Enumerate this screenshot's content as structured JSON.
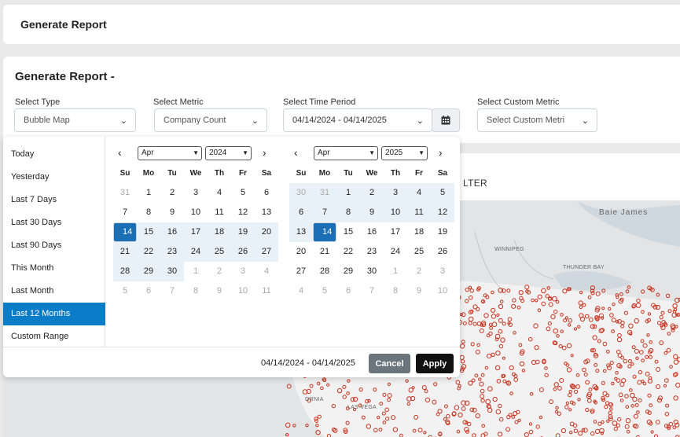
{
  "top": {
    "title": "Generate Report"
  },
  "main": {
    "heading": "Generate Report -",
    "type": {
      "label": "Select Type",
      "value": "Bubble Map"
    },
    "metric": {
      "label": "Select Metric",
      "value": "Company Count"
    },
    "period": {
      "label": "Select Time Period",
      "value": "04/14/2024 - 04/14/2025"
    },
    "custom": {
      "label": "Select Custom Metric",
      "value": "Select Custom Metri"
    }
  },
  "map": {
    "filter_label": "LTER",
    "labels": {
      "winnipeg": "WINNIPEG",
      "thunder_bay": "THUNDER BAY",
      "baie_james": "Baie James",
      "california": "ORNIA",
      "las_vegas": "LAS VEGA"
    },
    "dot_color": "#c8321e"
  },
  "picker": {
    "ranges": [
      "Today",
      "Yesterday",
      "Last 7 Days",
      "Last 30 Days",
      "Last 90 Days",
      "This Month",
      "Last Month",
      "Last 12 Months",
      "Custom Range"
    ],
    "active_range": "Last 12 Months",
    "weekdays": [
      "Su",
      "Mo",
      "Tu",
      "We",
      "Th",
      "Fr",
      "Sa"
    ],
    "left": {
      "month": "Apr",
      "year": "2024",
      "weeks": [
        [
          "31",
          "1",
          "2",
          "3",
          "4",
          "5",
          "6"
        ],
        [
          "7",
          "8",
          "9",
          "10",
          "11",
          "12",
          "13"
        ],
        [
          "14",
          "15",
          "16",
          "17",
          "18",
          "19",
          "20"
        ],
        [
          "21",
          "22",
          "23",
          "24",
          "25",
          "26",
          "27"
        ],
        [
          "28",
          "29",
          "30",
          "1",
          "2",
          "3",
          "4"
        ],
        [
          "5",
          "6",
          "7",
          "8",
          "9",
          "10",
          "11"
        ]
      ]
    },
    "right": {
      "month": "Apr",
      "year": "2025",
      "weeks": [
        [
          "30",
          "31",
          "1",
          "2",
          "3",
          "4",
          "5"
        ],
        [
          "6",
          "7",
          "8",
          "9",
          "10",
          "11",
          "12"
        ],
        [
          "13",
          "14",
          "15",
          "16",
          "17",
          "18",
          "19"
        ],
        [
          "20",
          "21",
          "22",
          "23",
          "24",
          "25",
          "26"
        ],
        [
          "27",
          "28",
          "29",
          "30",
          "1",
          "2",
          "3"
        ],
        [
          "4",
          "5",
          "6",
          "7",
          "8",
          "9",
          "10"
        ]
      ]
    },
    "range_text": "04/14/2024 - 04/14/2025",
    "cancel_label": "Cancel",
    "apply_label": "Apply",
    "accent": "#0a7cc8"
  }
}
